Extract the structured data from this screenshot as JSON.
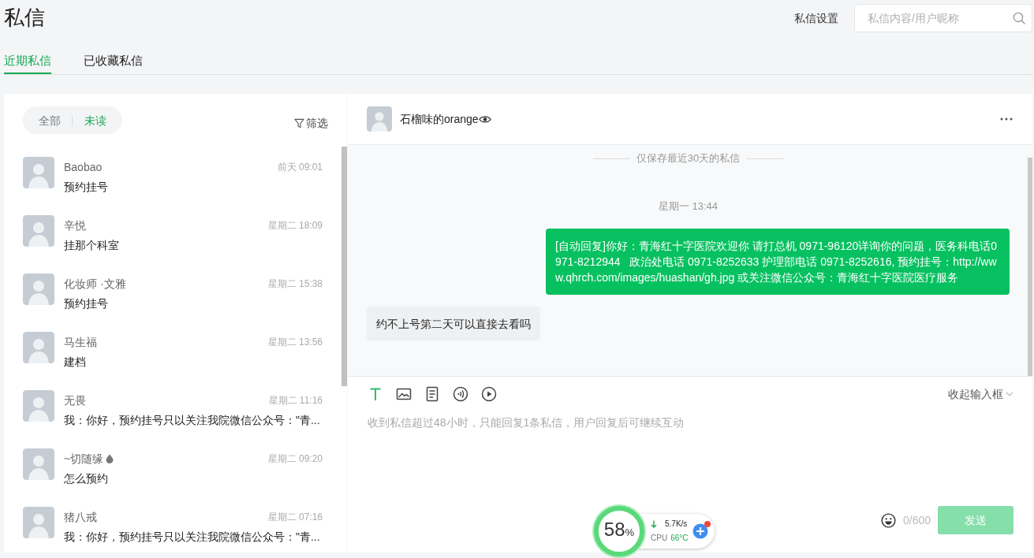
{
  "page": {
    "title": "私信",
    "settings_link": "私信设置",
    "search": {
      "placeholder": "私信内容/用户昵称"
    }
  },
  "tabs": [
    {
      "label": "近期私信",
      "selected": true
    },
    {
      "label": "已收藏私信",
      "selected": false
    }
  ],
  "conversation_list": {
    "filters": [
      {
        "label": "全部",
        "selected": false
      },
      {
        "label": "未读",
        "selected": true
      }
    ],
    "filter_button": "筛选",
    "conversations": [
      {
        "name": "Baobao",
        "time": "前天 09:01",
        "preview": "预约挂号",
        "emoji": false
      },
      {
        "name": "辛悦",
        "time": "星期二 18:09",
        "preview": "挂那个科室",
        "emoji": false
      },
      {
        "name": "化妆师 ·文雅",
        "time": "星期二 15:38",
        "preview": "预约挂号",
        "emoji": false
      },
      {
        "name": "马生福",
        "time": "星期二 13:56",
        "preview": "建档",
        "emoji": false
      },
      {
        "name": "无畏",
        "time": "星期二 11:16",
        "preview": "我：你好，预约挂号只以关注我院微信公众号：\"青...",
        "emoji": false
      },
      {
        "name": "~切随缘",
        "time": "星期二 09:20",
        "preview": "怎么预约",
        "emoji": true
      },
      {
        "name": "猪八戒",
        "time": "星期二 07:16",
        "preview": "我：你好，预约挂号只以关注我院微信公众号：\"青...",
        "emoji": false
      }
    ]
  },
  "chat": {
    "contact": {
      "name": "石榴味的orange",
      "emoji": true
    },
    "notice": "仅保存最近30天的私信",
    "messages": [
      {
        "kind": "time",
        "text": "星期一 13:44"
      },
      {
        "kind": "sent",
        "text": "[自动回复]你好：青海红十字医院欢迎你 请打总机 0971-96120详询你的问题，医务科电话0971-8212944   政治处电话 0971-8252633 护理部电话 0971-8252616, 预约挂号：http://www.qhrch.com/images/huashan/gh.jpg 或关注微信公众号：青海红十字医院医疗服务"
      },
      {
        "kind": "received",
        "text": "约不上号第二天可以直接去看吗"
      }
    ],
    "composer": {
      "tools": [
        {
          "kind": "text",
          "selected": true
        },
        {
          "kind": "image",
          "selected": false
        },
        {
          "kind": "document",
          "selected": false
        },
        {
          "kind": "audio",
          "selected": false
        },
        {
          "kind": "video",
          "selected": false
        }
      ],
      "collapse_label": "收起输入框",
      "placeholder": "收到私信超过48小时，只能回复1条私信，用户回复后可继续互动",
      "counter": "0/600",
      "send": {
        "label": "发送",
        "disabled": true
      }
    }
  },
  "speed_widget": {
    "percent": "58",
    "unit": "%",
    "download": "5.7K/s",
    "cpu_label": "CPU",
    "cpu_value": "66°C"
  }
}
